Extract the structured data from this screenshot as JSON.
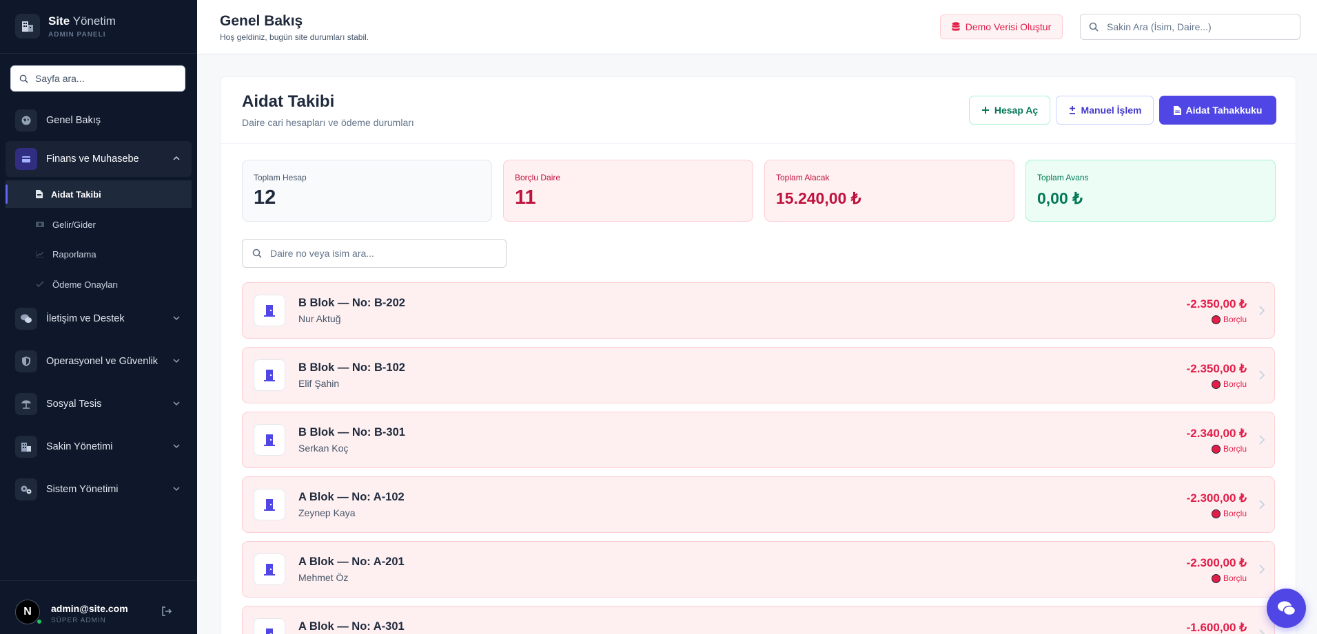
{
  "brand": {
    "title_bold": "Site",
    "title_rest": " Yönetim",
    "subtitle": "ADMIN PANELI"
  },
  "sidebar": {
    "search_placeholder": "Sayfa ara...",
    "items": [
      {
        "label": "Genel Bakış",
        "icon": "globe-icon"
      },
      {
        "label": "Finans ve Muhasebe",
        "icon": "wallet-icon",
        "expanded": true
      },
      {
        "label": "İletişim ve Destek",
        "icon": "chat-icon"
      },
      {
        "label": "Operasyonel ve Güvenlik",
        "icon": "shield-icon"
      },
      {
        "label": "Sosyal Tesis",
        "icon": "umbrella-icon"
      },
      {
        "label": "Sakin Yönetimi",
        "icon": "building-icon"
      },
      {
        "label": "Sistem Yönetimi",
        "icon": "gears-icon"
      }
    ],
    "sub_items": [
      {
        "label": "Aidat Takibi",
        "icon": "document-icon",
        "active": true
      },
      {
        "label": "Gelir/Gider",
        "icon": "money-icon"
      },
      {
        "label": "Raporlama",
        "icon": "chart-icon"
      },
      {
        "label": "Ödeme Onayları",
        "icon": "check-icon"
      }
    ]
  },
  "user": {
    "initial": "N",
    "email": "admin@site.com",
    "role": "SÜPER ADMIN"
  },
  "header": {
    "title": "Genel Bakış",
    "subtitle": "Hoş geldiniz, bugün site durumları stabil.",
    "demo_button": "Demo Verisi Oluştur",
    "search_placeholder": "Sakin Ara (İsim, Daire...)"
  },
  "page": {
    "title": "Aidat Takibi",
    "subtitle": "Daire cari hesapları ve ödeme durumları",
    "buttons": {
      "open_account": "Hesap Aç",
      "manual": "Manuel İşlem",
      "accrual": "Aidat Tahakkuku"
    },
    "stats": [
      {
        "label": "Toplam Hesap",
        "value": "12"
      },
      {
        "label": "Borçlu Daire",
        "value": "11"
      },
      {
        "label": "Toplam Alacak",
        "value": "15.240,00 ₺"
      },
      {
        "label": "Toplam Avans",
        "value": "0,00 ₺"
      }
    ],
    "list_search_placeholder": "Daire no veya isim ara...",
    "rows": [
      {
        "title": "B Blok — No: B-202",
        "name": "Nur Aktuğ",
        "amount": "-2.350,00 ₺",
        "status": "Borçlu"
      },
      {
        "title": "B Blok — No: B-102",
        "name": "Elif Şahin",
        "amount": "-2.350,00 ₺",
        "status": "Borçlu"
      },
      {
        "title": "B Blok — No: B-301",
        "name": "Serkan Koç",
        "amount": "-2.340,00 ₺",
        "status": "Borçlu"
      },
      {
        "title": "A Blok — No: A-102",
        "name": "Zeynep Kaya",
        "amount": "-2.300,00 ₺",
        "status": "Borçlu"
      },
      {
        "title": "A Blok — No: A-201",
        "name": "Mehmet Öz",
        "amount": "-2.300,00 ₺",
        "status": "Borçlu"
      },
      {
        "title": "A Blok — No: A-301",
        "name": "",
        "amount": "-1.600,00 ₺",
        "status": ""
      }
    ]
  },
  "colors": {
    "accent": "#4f46e5",
    "danger": "#e11d48",
    "success": "#047857",
    "sidebar_bg": "#0f172a"
  }
}
